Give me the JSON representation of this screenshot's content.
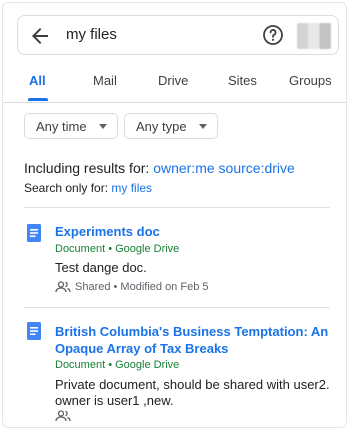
{
  "search": {
    "query": "my files"
  },
  "tabs": [
    {
      "label": "All",
      "active": true
    },
    {
      "label": "Mail"
    },
    {
      "label": "Drive"
    },
    {
      "label": "Sites"
    },
    {
      "label": "Groups"
    }
  ],
  "filters": {
    "time_label": "Any time",
    "type_label": "Any type"
  },
  "including": {
    "prefix": "Including results for:",
    "query": "owner:me source:drive"
  },
  "search_only": {
    "prefix": "Search only for:",
    "query": "my files"
  },
  "results": [
    {
      "title": "Experiments doc",
      "source": "Document • Google Drive",
      "snippet": "Test dange doc.",
      "meta": "Shared • Modified on Feb 5"
    },
    {
      "title": "British Columbia's Business Temptation: An Opaque Array of Tax Breaks",
      "source": "Document • Google Drive",
      "snippet": "Private document, should be shared with user2. owner is user1 ,new.",
      "meta": ""
    }
  ],
  "colors": {
    "accent": "#1a73e8",
    "source_green": "#188038",
    "doc_icon": "#4285f4"
  },
  "icons": [
    "back-arrow-icon",
    "help-icon",
    "avatar",
    "doc-icon",
    "shared-people-icon"
  ]
}
